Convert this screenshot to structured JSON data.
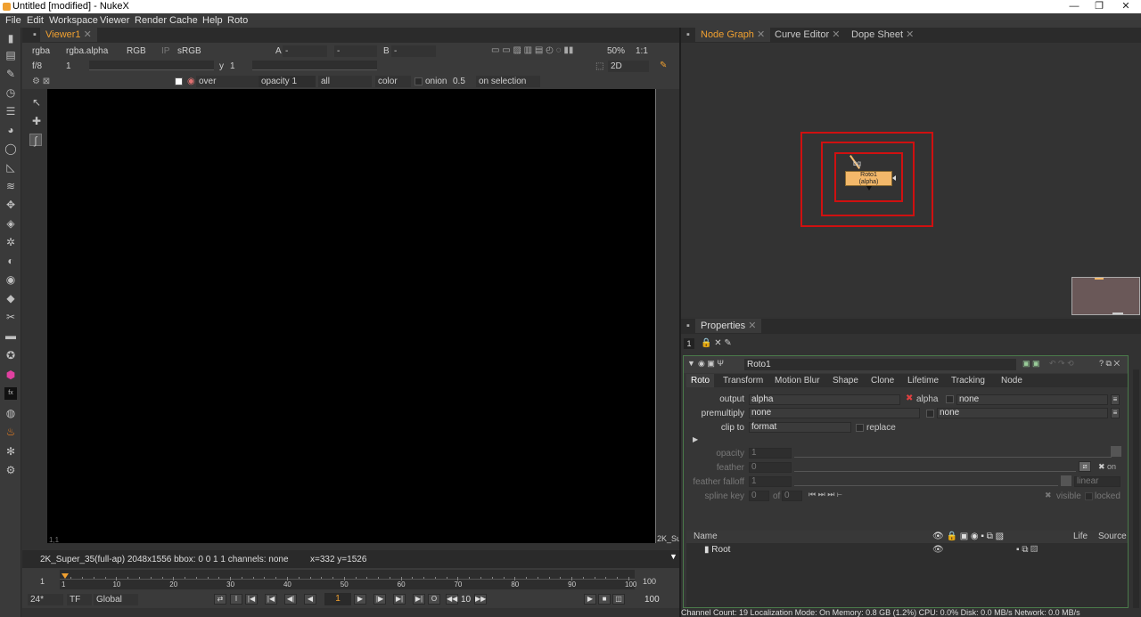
{
  "window": {
    "title": "Untitled [modified] - NukeX",
    "min": "—",
    "max": "❐",
    "close": "✕"
  },
  "menu": [
    "File",
    "Edit",
    "Workspace",
    "Viewer",
    "Render",
    "Cache",
    "Help",
    "Roto"
  ],
  "viewer": {
    "tab": "Viewer1",
    "channels": "rgba",
    "layer": "rgba.alpha",
    "display": "RGB",
    "ip": "IP",
    "lut": "sRGB",
    "a_label": "A",
    "a_val": "-",
    "b_label": "B",
    "b_val": "-",
    "zoom": "50%",
    "ratio": "1:1",
    "fstop": "f/8",
    "gain": "1",
    "gamma_label": "y",
    "gamma": "1",
    "view": "2D",
    "wipe_mode": "over",
    "opacity": "opacity 1",
    "all": "all",
    "color": "color",
    "onion": "onion",
    "onion_val": "0.5",
    "on_selection": "on selection",
    "info": "2K_Super_35(full-ap) 2048x1556  bbox: 0 0 1 1 channels: none",
    "coords": "x=332 y=1526",
    "corner_bl": "1,1",
    "corner_br": "2K_Su",
    "timeline": {
      "start": "1",
      "end": "100",
      "ticks": [
        "1",
        "10",
        "20",
        "30",
        "40",
        "50",
        "60",
        "70",
        "80",
        "90",
        "100"
      ]
    },
    "fps": "24*",
    "tf": "TF",
    "global": "Global",
    "frame": "1",
    "step": "10",
    "end_frame": "100"
  },
  "nodegraph": {
    "tabs": [
      "Node Graph",
      "Curve Editor",
      "Dope Sheet"
    ],
    "node_label": "Roto1",
    "node_sub": "(alpha)",
    "input": "bg"
  },
  "properties": {
    "tab": "Properties",
    "count": "1",
    "node_name": "Roto1",
    "tabs": [
      "Roto",
      "Transform",
      "Motion Blur",
      "Shape",
      "Clone",
      "Lifetime",
      "Tracking",
      "Node"
    ],
    "output_label": "output",
    "output_val": "alpha",
    "alpha_label": "alpha",
    "none1": "none",
    "premult_label": "premultiply",
    "premult_val": "none",
    "none2": "none",
    "clip_label": "clip to",
    "clip_val": "format",
    "replace": "replace",
    "opacity_label": "opacity",
    "opacity_val": "1",
    "feather_label": "feather",
    "feather_val": "0",
    "on": "on",
    "falloff_label": "feather falloff",
    "falloff_val": "1",
    "falloff_type": "linear",
    "spline_label": "spline key",
    "spline_val": "0",
    "of": "of",
    "of_val": "0",
    "visible": "visible",
    "locked": "locked",
    "tree_name": "Name",
    "tree_life": "Life",
    "tree_source": "Source",
    "root": "Root"
  },
  "status": "Channel Count: 19 Localization Mode: On Memory: 0.8 GB (1.2%) CPU: 0.0% Disk: 0.0 MB/s Network: 0.0 MB/s",
  "colors": {
    "accent": "#f0a030",
    "node": "#f3b86a",
    "highlight": "#d01010"
  }
}
